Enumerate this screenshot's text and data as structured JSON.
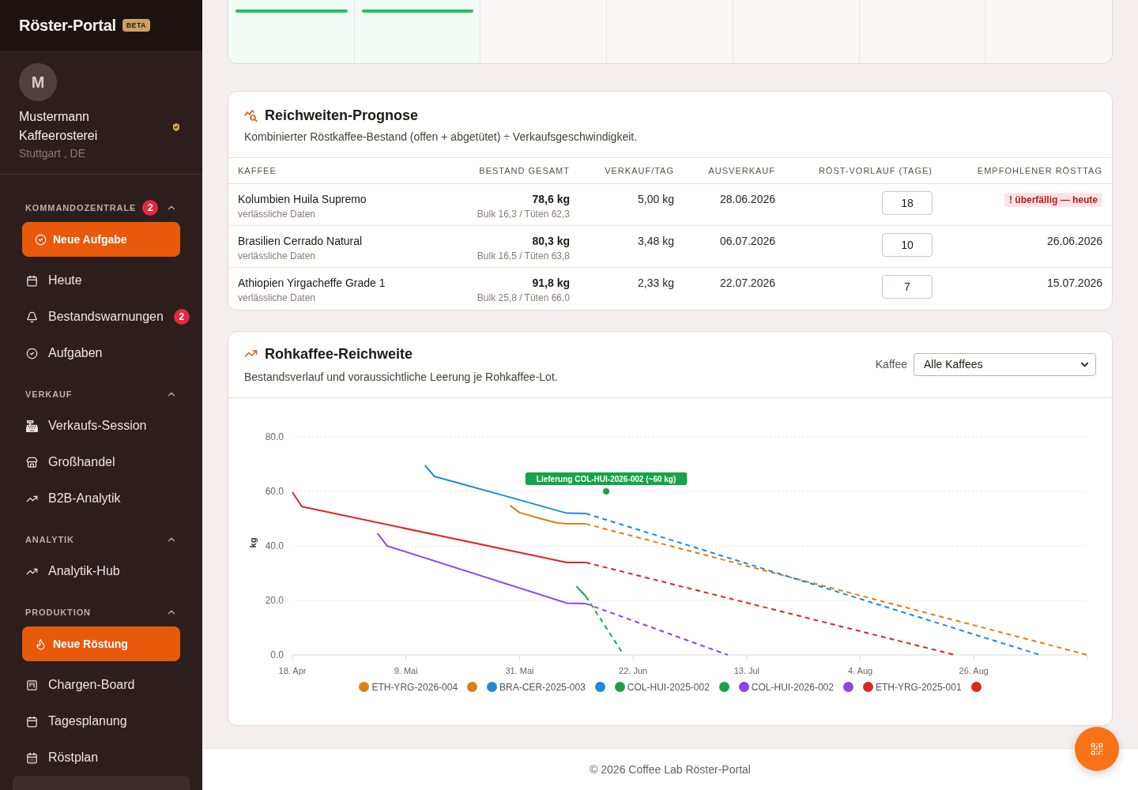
{
  "sidebar": {
    "brand": {
      "title": "Röster-Portal",
      "badge": "BETA"
    },
    "profile": {
      "initial": "M",
      "name": "Mustermann Kaffeerosterei",
      "location": "Stuttgart , DE",
      "verified": true
    },
    "sections": [
      {
        "title": "KOMMANDOZENTRALE",
        "badge": "2",
        "expanded": true,
        "items": [
          {
            "kind": "action",
            "label": "Neue Aufgabe"
          },
          {
            "kind": "link",
            "label": "Heute",
            "selected": false
          },
          {
            "kind": "link",
            "label": "Bestandswarnungen",
            "badge": "2",
            "selected": false
          },
          {
            "kind": "link",
            "label": "Aufgaben",
            "selected": false
          }
        ]
      },
      {
        "title": "VERKAUF",
        "expanded": true,
        "items": [
          {
            "kind": "link",
            "label": "Verkaufs-Session",
            "selected": false
          },
          {
            "kind": "link",
            "label": "Großhandel",
            "selected": false
          },
          {
            "kind": "link",
            "label": "B2B-Analytik",
            "selected": false
          }
        ]
      },
      {
        "title": "ANALYTIK",
        "expanded": true,
        "items": [
          {
            "kind": "link",
            "label": "Analytik-Hub",
            "selected": false
          }
        ]
      },
      {
        "title": "PRODUKTION",
        "expanded": true,
        "items": [
          {
            "kind": "action",
            "label": "Neue Röstung"
          },
          {
            "kind": "link",
            "label": "Chargen-Board",
            "selected": false
          },
          {
            "kind": "link",
            "label": "Tagesplanung",
            "selected": false
          },
          {
            "kind": "link",
            "label": "Röstplan",
            "selected": false
          },
          {
            "kind": "link",
            "selected": true
          }
        ]
      }
    ]
  },
  "calendar_strip": {
    "days": [
      {
        "active": true
      },
      {
        "active": true
      },
      {
        "active": false
      },
      {
        "active": false
      },
      {
        "active": false
      },
      {
        "active": false
      },
      {
        "active": false
      }
    ]
  },
  "forecast": {
    "title": "Reichweiten-Prognose",
    "subtitle": "Kombinierter Röstkaffee-Bestand (offen + abgetütet) ÷ Verkaufsgeschwindigkeit.",
    "columns": [
      "KAFFEE",
      "BESTAND GESAMT",
      "VERKAUF/TAG",
      "AUSVERKAUF",
      "RÖST-VORLAUF (TAGE)",
      "EMPFOHLENER RÖSTTAG"
    ],
    "rows": [
      {
        "coffee": "Kolumbien Huila Supremo",
        "data_quality": "verlässliche Daten",
        "stock_total": "78,6 kg",
        "stock_split": "Bulk 16,3 / Tüten 62,3",
        "sales_per_day": "5,00 kg",
        "sellout": "28.06.2026",
        "lead_time_days": "18",
        "recommended": {
          "text": "! überfällig — heute",
          "overdue": true
        }
      },
      {
        "coffee": "Brasilien Cerrado Natural",
        "data_quality": "verlässliche Daten",
        "stock_total": "80,3 kg",
        "stock_split": "Bulk 16,5 / Tüten 63,8",
        "sales_per_day": "3,48 kg",
        "sellout": "06.07.2026",
        "lead_time_days": "10",
        "recommended": {
          "text": "26.06.2026",
          "overdue": false
        }
      },
      {
        "coffee": "Athiopien Yirgacheffe Grade 1",
        "data_quality": "verlässliche Daten",
        "stock_total": "91,8 kg",
        "stock_split": "Bulk 25,8 / Tüten 66,0",
        "sales_per_day": "2,33 kg",
        "sellout": "22.07.2026",
        "lead_time_days": "7",
        "recommended": {
          "text": "15.07.2026",
          "overdue": false
        }
      }
    ]
  },
  "raw_coffee": {
    "title": "Rohkaffee-Reichweite",
    "subtitle": "Bestandsverlauf und voraussichtliche Leerung je Rohkaffee-Lot.",
    "filter": {
      "label": "Kaffee",
      "value": "Alle Kaffees"
    },
    "chart_data": {
      "type": "line",
      "ylabel": "kg",
      "grid": true,
      "legend": "bottom",
      "categories": [
        "18. Apr",
        null,
        null,
        null,
        null,
        null,
        null,
        null,
        null,
        null,
        null,
        null,
        "9. Mai",
        null,
        null,
        null,
        null,
        null,
        null,
        null,
        null,
        null,
        null,
        null,
        "31. Mai",
        null,
        null,
        null,
        null,
        null,
        null,
        null,
        null,
        null,
        null,
        null,
        "22. Jun",
        null,
        null,
        null,
        null,
        null,
        null,
        null,
        null,
        null,
        null,
        null,
        "13. Jul",
        null,
        null,
        null,
        null,
        null,
        null,
        null,
        null,
        null,
        null,
        null,
        "4. Aug",
        null,
        null,
        null,
        null,
        null,
        null,
        null,
        null,
        null,
        null,
        null,
        "26. Aug",
        null,
        null,
        null,
        null,
        null,
        null,
        null,
        null,
        null,
        null,
        null,
        null
      ],
      "ylim": [
        0,
        80
      ],
      "yticks": [
        {
          "value": 0,
          "label": "0.0"
        },
        {
          "value": 20,
          "label": "20.0"
        },
        {
          "value": 40,
          "label": "40.0"
        },
        {
          "value": 60,
          "label": "60.0"
        },
        {
          "value": 80,
          "label": "80.0"
        }
      ],
      "series": [
        {
          "name": "ETH-YRG-2026-004",
          "color": "#d98213",
          "line_style": "solid",
          "values": [
            null,
            null,
            null,
            null,
            null,
            null,
            null,
            null,
            null,
            null,
            null,
            null,
            null,
            null,
            null,
            null,
            null,
            null,
            null,
            null,
            null,
            null,
            null,
            54.8,
            52.2,
            null,
            50.2,
            null,
            48.4,
            48.1,
            null,
            48.1,
            null,
            null,
            null,
            null,
            null,
            null,
            null,
            null,
            null,
            null,
            null,
            null,
            null,
            null,
            null,
            null,
            null,
            null,
            null,
            null,
            null,
            null,
            null,
            null,
            null,
            null,
            null,
            null,
            null,
            null,
            null,
            null,
            null,
            null,
            null,
            null,
            null,
            null,
            null,
            null,
            null,
            null,
            null,
            null,
            null,
            null,
            null,
            null,
            null,
            null,
            null,
            null,
            null
          ]
        },
        {
          "color": "#d98213",
          "line_style": "dashed",
          "values": [
            null,
            null,
            null,
            null,
            null,
            null,
            null,
            null,
            null,
            null,
            null,
            null,
            null,
            null,
            null,
            null,
            null,
            null,
            null,
            null,
            null,
            null,
            null,
            null,
            null,
            null,
            null,
            null,
            null,
            null,
            null,
            48.1,
            null,
            null,
            null,
            null,
            null,
            null,
            null,
            null,
            null,
            null,
            null,
            null,
            null,
            null,
            null,
            null,
            null,
            null,
            null,
            null,
            null,
            null,
            null,
            null,
            null,
            null,
            null,
            null,
            null,
            null,
            null,
            null,
            null,
            null,
            null,
            null,
            null,
            null,
            null,
            null,
            null,
            null,
            null,
            null,
            null,
            null,
            null,
            null,
            null,
            null,
            null,
            null,
            0
          ]
        },
        {
          "name": "BRA-CER-2025-003",
          "color": "#1c8ad6",
          "line_style": "solid",
          "values": [
            null,
            null,
            null,
            null,
            null,
            null,
            null,
            null,
            null,
            null,
            null,
            null,
            null,
            null,
            69.6,
            65.5,
            null,
            null,
            62.6,
            null,
            null,
            null,
            58.8,
            null,
            null,
            null,
            null,
            null,
            null,
            52.0,
            null,
            51.9,
            null,
            null,
            null,
            null,
            null,
            null,
            null,
            null,
            null,
            null,
            null,
            null,
            null,
            null,
            null,
            null,
            null,
            null,
            null,
            null,
            null,
            null,
            null,
            null,
            null,
            null,
            null,
            null,
            null,
            null,
            null,
            null,
            null,
            null,
            null,
            null,
            null,
            null,
            null,
            null,
            null,
            null,
            null,
            null,
            null,
            null,
            null,
            null,
            null,
            null,
            null,
            null,
            null
          ]
        },
        {
          "color": "#1c8ad6",
          "line_style": "dashed",
          "values": [
            null,
            null,
            null,
            null,
            null,
            null,
            null,
            null,
            null,
            null,
            null,
            null,
            null,
            null,
            null,
            null,
            null,
            null,
            null,
            null,
            null,
            null,
            null,
            null,
            null,
            null,
            null,
            null,
            null,
            null,
            null,
            51.9,
            null,
            null,
            null,
            null,
            null,
            null,
            null,
            null,
            null,
            null,
            null,
            null,
            null,
            null,
            null,
            null,
            null,
            null,
            null,
            null,
            null,
            null,
            null,
            null,
            null,
            null,
            null,
            null,
            null,
            null,
            null,
            null,
            null,
            null,
            null,
            null,
            null,
            null,
            null,
            null,
            null,
            null,
            null,
            null,
            null,
            null,
            null,
            0,
            null,
            null,
            null,
            null,
            null
          ]
        },
        {
          "name": "COL-HUI-2025-002",
          "color": "#16a34a",
          "line_style": "solid",
          "values": [
            null,
            null,
            null,
            null,
            null,
            null,
            null,
            null,
            null,
            null,
            null,
            null,
            null,
            null,
            null,
            null,
            null,
            null,
            null,
            null,
            null,
            null,
            null,
            null,
            null,
            null,
            null,
            null,
            null,
            null,
            25.2,
            21.5,
            null,
            null,
            null,
            null,
            null,
            null,
            null,
            null,
            null,
            null,
            null,
            null,
            null,
            null,
            null,
            null,
            null,
            null,
            null,
            null,
            null,
            null,
            null,
            null,
            null,
            null,
            null,
            null,
            null,
            null,
            null,
            null,
            null,
            null,
            null,
            null,
            null,
            null,
            null,
            null,
            null,
            null,
            null,
            null,
            null,
            null,
            null,
            null,
            null,
            null,
            null,
            null,
            null
          ]
        },
        {
          "color": "#16a34a",
          "line_style": "dashed",
          "values": [
            null,
            null,
            null,
            null,
            null,
            null,
            null,
            null,
            null,
            null,
            null,
            null,
            null,
            null,
            null,
            null,
            null,
            null,
            null,
            null,
            null,
            null,
            null,
            null,
            null,
            null,
            null,
            null,
            null,
            null,
            null,
            21.5,
            null,
            null,
            null,
            0,
            null,
            null,
            null,
            null,
            null,
            null,
            null,
            null,
            null,
            null,
            null,
            null,
            null,
            null,
            null,
            null,
            null,
            null,
            null,
            null,
            null,
            null,
            null,
            null,
            null,
            null,
            null,
            null,
            null,
            null,
            null,
            null,
            null,
            null,
            null,
            null,
            null,
            null,
            null,
            null,
            null,
            null,
            null,
            null,
            null,
            null,
            null,
            null,
            null
          ]
        },
        {
          "name": "COL-HUI-2026-002",
          "color": "#8b44ee",
          "line_style": "solid",
          "values": [
            null,
            null,
            null,
            null,
            null,
            null,
            null,
            null,
            null,
            44.6,
            40,
            null,
            null,
            null,
            null,
            null,
            null,
            null,
            null,
            null,
            null,
            null,
            null,
            null,
            null,
            null,
            null,
            null,
            null,
            19.0,
            null,
            18.8,
            null,
            null,
            null,
            null,
            null,
            null,
            null,
            null,
            null,
            null,
            null,
            null,
            null,
            null,
            null,
            null,
            null,
            null,
            null,
            null,
            null,
            null,
            null,
            null,
            null,
            null,
            null,
            null,
            null,
            null,
            null,
            null,
            null,
            null,
            null,
            null,
            null,
            null,
            null,
            null,
            null,
            null,
            null,
            null,
            null,
            null,
            null,
            null,
            null,
            null,
            null,
            null,
            null
          ]
        },
        {
          "color": "#8b44ee",
          "line_style": "dashed",
          "values": [
            null,
            null,
            null,
            null,
            null,
            null,
            null,
            null,
            null,
            null,
            null,
            null,
            null,
            null,
            null,
            null,
            null,
            null,
            null,
            null,
            null,
            null,
            null,
            null,
            null,
            null,
            null,
            null,
            null,
            null,
            null,
            18.8,
            null,
            null,
            null,
            null,
            null,
            null,
            null,
            null,
            null,
            null,
            null,
            null,
            null,
            null,
            0,
            null,
            null,
            null,
            null,
            null,
            null,
            null,
            null,
            null,
            null,
            null,
            null,
            null,
            null,
            null,
            null,
            null,
            null,
            null,
            null,
            null,
            null,
            null,
            null,
            null,
            null,
            null,
            null,
            null,
            null,
            null,
            null,
            null,
            null,
            null,
            null,
            null,
            null
          ]
        },
        {
          "name": "ETH-YRG-2025-001",
          "color": "#dc2626",
          "line_style": "solid",
          "values": [
            59.7,
            54.4,
            null,
            null,
            null,
            null,
            null,
            null,
            null,
            null,
            null,
            null,
            null,
            null,
            null,
            null,
            null,
            null,
            null,
            null,
            null,
            null,
            null,
            null,
            null,
            null,
            null,
            null,
            null,
            33.9,
            null,
            33.9,
            null,
            null,
            null,
            null,
            null,
            null,
            null,
            null,
            null,
            null,
            null,
            null,
            null,
            null,
            null,
            null,
            null,
            null,
            null,
            null,
            null,
            null,
            null,
            null,
            null,
            null,
            null,
            null,
            null,
            null,
            null,
            null,
            null,
            null,
            null,
            null,
            null,
            null,
            null,
            null,
            null,
            null,
            null,
            null,
            null,
            null,
            null,
            null,
            null,
            null,
            null,
            null,
            null
          ]
        },
        {
          "color": "#dc2626",
          "line_style": "dashed",
          "values": [
            null,
            null,
            null,
            null,
            null,
            null,
            null,
            null,
            null,
            null,
            null,
            null,
            null,
            null,
            null,
            null,
            null,
            null,
            null,
            null,
            null,
            null,
            null,
            null,
            null,
            null,
            null,
            null,
            null,
            null,
            null,
            33.9,
            null,
            null,
            null,
            null,
            null,
            null,
            null,
            null,
            null,
            null,
            null,
            null,
            null,
            null,
            null,
            null,
            null,
            null,
            null,
            null,
            null,
            null,
            null,
            null,
            null,
            null,
            null,
            null,
            null,
            null,
            null,
            null,
            null,
            null,
            null,
            null,
            null,
            null,
            0,
            null,
            null,
            null,
            null,
            null,
            null,
            null,
            null,
            null,
            null,
            null,
            null,
            null,
            null
          ]
        }
      ],
      "annotations": [
        "Lieferung COL-HUI-2026-002 (~60 kg)"
      ]
    }
  },
  "footer": {
    "text": "© 2026 Coffee Lab Röster-Portal"
  }
}
